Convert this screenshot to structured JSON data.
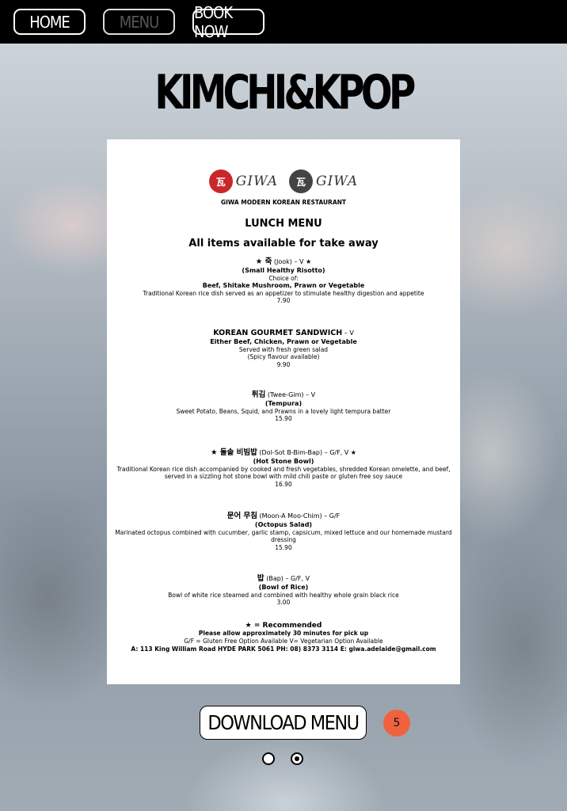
{
  "nav": {
    "home": "HOME",
    "menu": "MENU",
    "book": "BOOK NOW"
  },
  "brand": "KIMCHI&KPOP",
  "menu": {
    "logo_text": "GIWA",
    "logo_glyph": "瓦",
    "restaurant": "GIWA MODERN KOREAN RESTAURANT",
    "heading": "LUNCH MENU",
    "takeaway": "All items available for take away",
    "items": [
      {
        "title": "★ 죽",
        "sub": " (Jook) – V ★",
        "subtitle": "(Small Healthy Risotto)",
        "line1": "Choice of:",
        "line2": "Beef, Shitake Mushroom, Prawn or Vegetable",
        "desc": "Traditional Korean rice dish served as an appetizer to stimulate healthy digestion and appetite",
        "price": "7.90"
      },
      {
        "title": "KOREAN GOURMET SANDWICH",
        "sub": " – V",
        "line1": "Either Beef, Chicken, Prawn or Vegetable",
        "line2": "Served with fresh green salad",
        "desc": "(Spicy flavour available)",
        "price": "9.90"
      },
      {
        "title": "튀김",
        "sub": " (Twee-Gim) – V",
        "subtitle": "(Tempura)",
        "desc": "Sweet Potato, Beans, Squid, and Prawns in a lovely light tempura batter",
        "price": "15.90"
      },
      {
        "title": "★ 돌솥 비빔밥",
        "sub": " (Dol-Sot B-Bim-Bap) – G/F, V ★",
        "subtitle": "(Hot Stone Bowl)",
        "desc": "Traditional Korean rice dish accompanied by cooked and fresh vegetables, shredded Korean omelette, and beef, served in a sizzling hot stone bowl with mild chili paste or gluten free soy sauce",
        "price": "16.90"
      },
      {
        "title": "문어 무침",
        "sub": " (Moon-A Moo-Chim) – G/F",
        "subtitle": "(Octopus Salad)",
        "desc": "Marinated octopus combined with cucumber, garlic stamp, capsicum, mixed lettuce and our homemade mustard dressing",
        "price": "15.90"
      },
      {
        "title": "밥",
        "sub": " (Bap) – G/F, V",
        "subtitle": "(Bowl of Rice)",
        "desc": "Bowl of white rice steamed and combined with healthy whole grain black rice",
        "price": "3.00"
      }
    ],
    "footer": {
      "recommended": "★ = Recommended",
      "wait": "Please allow approximately 30 minutes for pick up",
      "legend": "G/F = Gluten Free Option Available V= Vegetarian Option Available",
      "address": "A: 113 King William Road HYDE PARK 5061 PH: 08) 8373 3114 E: giwa.adelaide@gmail.com"
    }
  },
  "download": "DOWNLOAD MENU",
  "badge": "5",
  "colors": {
    "accent": "#f0623e",
    "logo_red": "#c8282c"
  }
}
